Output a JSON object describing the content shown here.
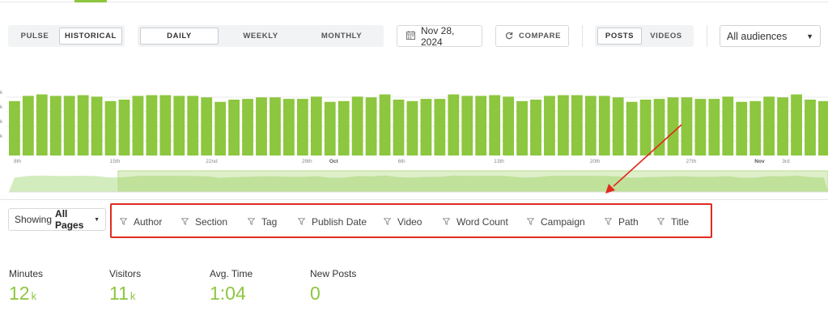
{
  "colors": {
    "accent": "#8dc63f",
    "annotation": "#e02a1f",
    "mini_fill": "#d3ecbd"
  },
  "modes": [
    {
      "label": "PULSE",
      "active": false
    },
    {
      "label": "HISTORICAL",
      "active": true
    }
  ],
  "periods": [
    {
      "label": "DAILY",
      "active": true
    },
    {
      "label": "WEEKLY",
      "active": false
    },
    {
      "label": "MONTHLY",
      "active": false
    }
  ],
  "date_picker": {
    "icon": "calendar-icon",
    "value": "Nov 28, 2024"
  },
  "compare": {
    "icon": "refresh-icon",
    "label": "COMPARE"
  },
  "content_types": [
    {
      "label": "POSTS",
      "active": true
    },
    {
      "label": "VIDEOS",
      "active": false
    }
  ],
  "audience_select": {
    "value": "All audiences"
  },
  "chart_data": {
    "type": "bar",
    "y_tick_labels": [
      "k",
      "k",
      "k",
      "k"
    ],
    "x_tick_labels": [
      {
        "label": "8th",
        "bold": false,
        "index": 0
      },
      {
        "label": "15th",
        "bold": false,
        "index": 7
      },
      {
        "label": "22nd",
        "bold": false,
        "index": 14
      },
      {
        "label": "29th",
        "bold": false,
        "index": 21
      },
      {
        "label": "Oct",
        "bold": true,
        "index": 23
      },
      {
        "label": "6th",
        "bold": false,
        "index": 28
      },
      {
        "label": "13th",
        "bold": false,
        "index": 35
      },
      {
        "label": "20th",
        "bold": false,
        "index": 42
      },
      {
        "label": "27th",
        "bold": false,
        "index": 49
      },
      {
        "label": "Nov",
        "bold": true,
        "index": 54
      },
      {
        "label": "3rd",
        "bold": false,
        "index": 56
      }
    ],
    "values": [
      0.73,
      0.8,
      0.82,
      0.8,
      0.8,
      0.81,
      0.79,
      0.73,
      0.75,
      0.8,
      0.81,
      0.81,
      0.8,
      0.8,
      0.78,
      0.72,
      0.75,
      0.76,
      0.78,
      0.78,
      0.76,
      0.76,
      0.79,
      0.72,
      0.73,
      0.79,
      0.78,
      0.82,
      0.75,
      0.73,
      0.76,
      0.76,
      0.82,
      0.8,
      0.8,
      0.81,
      0.79,
      0.73,
      0.75,
      0.8,
      0.81,
      0.81,
      0.8,
      0.8,
      0.78,
      0.72,
      0.75,
      0.76,
      0.78,
      0.78,
      0.76,
      0.76,
      0.79,
      0.72,
      0.73,
      0.79,
      0.78,
      0.82,
      0.75,
      0.73
    ],
    "ylim": [
      0,
      1
    ],
    "grid": true
  },
  "showing": {
    "label": "Showing",
    "value": "All Pages"
  },
  "filters": [
    {
      "label": "Author",
      "icon": "filter-icon"
    },
    {
      "label": "Section",
      "icon": "filter-icon"
    },
    {
      "label": "Tag",
      "icon": "filter-icon"
    },
    {
      "label": "Publish Date",
      "icon": "filter-icon"
    },
    {
      "label": "Video",
      "icon": "filter-icon"
    },
    {
      "label": "Word Count",
      "icon": "filter-icon"
    },
    {
      "label": "Campaign",
      "icon": "filter-icon"
    },
    {
      "label": "Path",
      "icon": "filter-icon"
    },
    {
      "label": "Title",
      "icon": "filter-icon"
    }
  ],
  "metrics": [
    {
      "label": "Minutes",
      "value": "12",
      "unit": "k"
    },
    {
      "label": "Visitors",
      "value": "11",
      "unit": "k"
    },
    {
      "label": "Avg. Time",
      "value": "1:04",
      "unit": ""
    },
    {
      "label": "New Posts",
      "value": "0",
      "unit": ""
    }
  ]
}
